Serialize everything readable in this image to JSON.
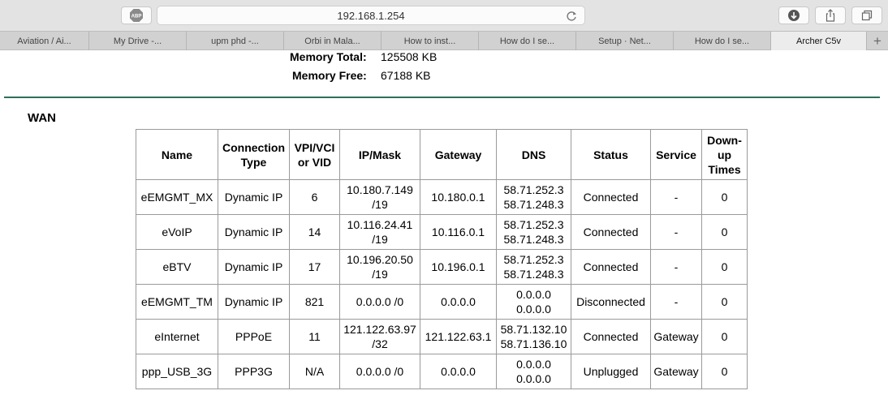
{
  "browser": {
    "url": "192.168.1.254",
    "abp_label": "ABP",
    "tabs": [
      "Aviation / Ai...",
      "My Drive -...",
      "upm phd -...",
      "Orbi in Mala...",
      "How to inst...",
      "How do I se...",
      "Setup · Net...",
      "How do I se...",
      "Archer C5v"
    ],
    "active_tab_index": 8,
    "new_tab_label": "+"
  },
  "memory": {
    "total_label": "Memory Total:",
    "total_value": "125508 KB",
    "free_label": "Memory Free:",
    "free_value": "67188 KB"
  },
  "wan": {
    "title": "WAN",
    "headers": {
      "name": "Name",
      "connection_type": "Connection Type",
      "vpi": "VPI/VCI or VID",
      "ip_mask": "IP/Mask",
      "gateway": "Gateway",
      "dns": "DNS",
      "status": "Status",
      "service": "Service",
      "down_up": "Down-up Times"
    },
    "rows": [
      {
        "name": "eEMGMT_MX",
        "type": "Dynamic IP",
        "vid": "6",
        "ip": "10.180.7.149",
        "mask": "/19",
        "gateway": "10.180.0.1",
        "dns1": "58.71.252.3",
        "dns2": "58.71.248.3",
        "status": "Connected",
        "service": "-",
        "times": "0"
      },
      {
        "name": "eVoIP",
        "type": "Dynamic IP",
        "vid": "14",
        "ip": "10.116.24.41",
        "mask": "/19",
        "gateway": "10.116.0.1",
        "dns1": "58.71.252.3",
        "dns2": "58.71.248.3",
        "status": "Connected",
        "service": "-",
        "times": "0"
      },
      {
        "name": "eBTV",
        "type": "Dynamic IP",
        "vid": "17",
        "ip": "10.196.20.50",
        "mask": "/19",
        "gateway": "10.196.0.1",
        "dns1": "58.71.252.3",
        "dns2": "58.71.248.3",
        "status": "Connected",
        "service": "-",
        "times": "0"
      },
      {
        "name": "eEMGMT_TM",
        "type": "Dynamic IP",
        "vid": "821",
        "ip": "0.0.0.0 /0",
        "mask": "",
        "gateway": "0.0.0.0",
        "dns1": "0.0.0.0",
        "dns2": "0.0.0.0",
        "status": "Disconnected",
        "service": "-",
        "times": "0"
      },
      {
        "name": "eInternet",
        "type": "PPPoE",
        "vid": "11",
        "ip": "121.122.63.97",
        "mask": "/32",
        "gateway": "121.122.63.1",
        "dns1": "58.71.132.10",
        "dns2": "58.71.136.10",
        "status": "Connected",
        "service": "Gateway",
        "times": "0"
      },
      {
        "name": "ppp_USB_3G",
        "type": "PPP3G",
        "vid": "N/A",
        "ip": "0.0.0.0 /0",
        "mask": "",
        "gateway": "0.0.0.0",
        "dns1": "0.0.0.0",
        "dns2": "0.0.0.0",
        "status": "Unplugged",
        "service": "Gateway",
        "times": "0"
      }
    ]
  }
}
